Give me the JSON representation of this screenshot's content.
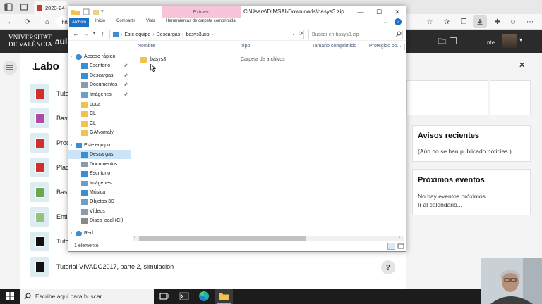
{
  "browser": {
    "tab_title": "2023-24-",
    "address_fragment": "http",
    "profile_fragment": "nte"
  },
  "site": {
    "logo_line1": "VNIVERSITAT",
    "logo_line2": "DE VALÈNCIA",
    "app_name": "aul",
    "course_title": "Labo",
    "activities": [
      {
        "name": "Tutor",
        "color": "#d12e2e"
      },
      {
        "name": "Basy",
        "color": "#b04aa8"
      },
      {
        "name": "Proc",
        "color": "#d12e2e"
      },
      {
        "name": "Plac",
        "color": "#d12e2e"
      },
      {
        "name": "Basy",
        "color": "#6aa84f"
      },
      {
        "name": "Enti",
        "color": "#93c47d"
      },
      {
        "name": "Tutor",
        "color": "#111111"
      },
      {
        "name": "Tutorial VIVADO2017, parte 2, simulación",
        "color": "#111111"
      }
    ],
    "recent_title": "Avisos recientes",
    "recent_text": "(Aún no se han publicado noticias.)",
    "events_title": "Próximos eventos",
    "events_text": "No hay eventos próximos",
    "events_link": "Ir al calendario..."
  },
  "explorer": {
    "extract_tab": "Extraer",
    "path": "C:\\Users\\DIMSAI\\Downloads\\basys3.zip",
    "ribbon_tabs": [
      "Archivo",
      "Inicio",
      "Compartir",
      "Vista",
      "Herramientas de carpeta comprimida"
    ],
    "breadcrumb": [
      "Este equipo",
      "Descargas",
      "basys3.zip"
    ],
    "search_placeholder": "Buscar en basys3.zip",
    "columns": [
      "Nombre",
      "Tipo",
      "Tamaño comprimido",
      "Protegido po..."
    ],
    "nav_items": [
      {
        "label": "Acceso rápido",
        "icon": "star-icon",
        "indent": 0,
        "pinned": false,
        "group": true
      },
      {
        "label": "Escritorio",
        "icon": "desktop-icon",
        "indent": 1,
        "pinned": true
      },
      {
        "label": "Descargas",
        "icon": "download-icon",
        "indent": 1,
        "pinned": true
      },
      {
        "label": "Documentos",
        "icon": "document-icon",
        "indent": 1,
        "pinned": true
      },
      {
        "label": "Imágenes",
        "icon": "image-icon",
        "indent": 1,
        "pinned": true
      },
      {
        "label": "boca",
        "icon": "folder-icon",
        "indent": 1,
        "pinned": false
      },
      {
        "label": "CL",
        "icon": "folder-icon",
        "indent": 1,
        "pinned": false
      },
      {
        "label": "CL",
        "icon": "folder-icon",
        "indent": 1,
        "pinned": false
      },
      {
        "label": "GANomaly",
        "icon": "folder-icon",
        "indent": 1,
        "pinned": false
      },
      {
        "label": "Este equipo",
        "icon": "computer-icon",
        "indent": 0,
        "pinned": false,
        "group": true
      },
      {
        "label": "Descargas",
        "icon": "download-icon",
        "indent": 1,
        "pinned": false,
        "selected": true
      },
      {
        "label": "Documentos",
        "icon": "document-icon",
        "indent": 1,
        "pinned": false
      },
      {
        "label": "Escritorio",
        "icon": "desktop-icon",
        "indent": 1,
        "pinned": false
      },
      {
        "label": "Imágenes",
        "icon": "image-icon",
        "indent": 1,
        "pinned": false
      },
      {
        "label": "Música",
        "icon": "music-icon",
        "indent": 1,
        "pinned": false
      },
      {
        "label": "Objetos 3D",
        "icon": "cube-icon",
        "indent": 1,
        "pinned": false
      },
      {
        "label": "Vídeos",
        "icon": "video-icon",
        "indent": 1,
        "pinned": false
      },
      {
        "label": "Disco local (C:)",
        "icon": "drive-icon",
        "indent": 1,
        "pinned": false
      },
      {
        "label": "Red",
        "icon": "network-icon",
        "indent": 0,
        "pinned": false,
        "group": true
      }
    ],
    "files": [
      {
        "name": "basys3",
        "type": "Carpeta de archivos",
        "size": "",
        "protected": ""
      }
    ],
    "status": "1 elemento"
  },
  "taskbar": {
    "search_placeholder": "Escribe aquí para buscar."
  },
  "colors": {
    "accent": "#1e6fc6",
    "extract_tab": "#f7c4d9",
    "header_dark": "#2b2b2b",
    "folder": "#f2c14e"
  }
}
